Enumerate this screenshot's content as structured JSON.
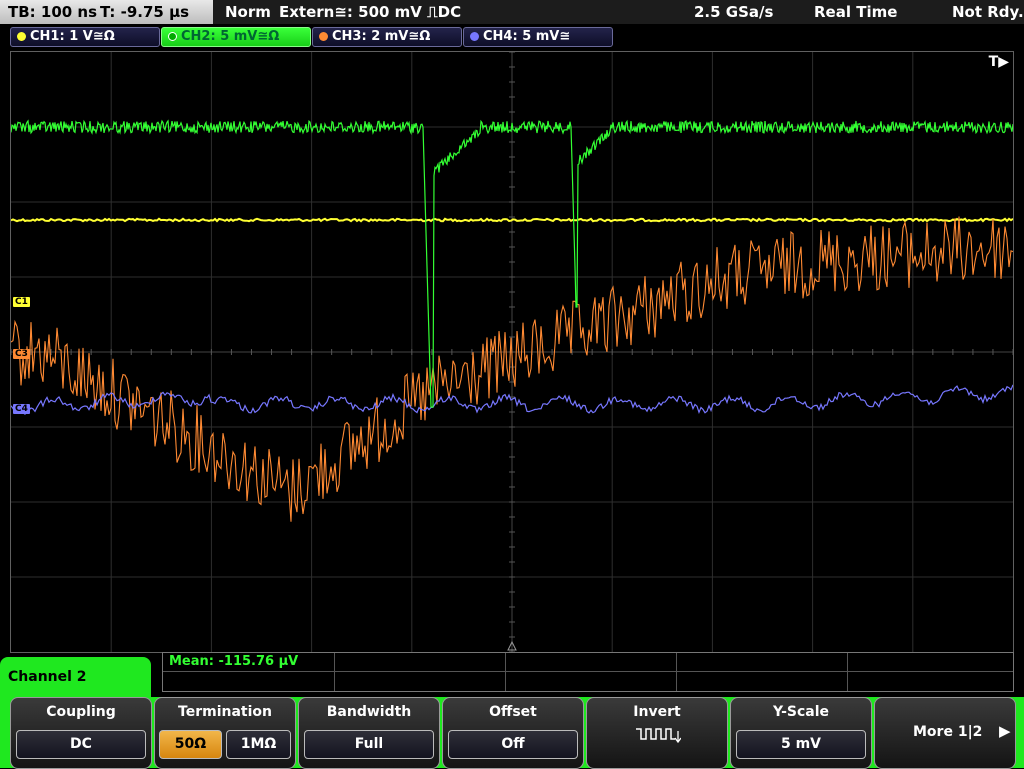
{
  "topbar": {
    "timebase": "TB: 100 ns",
    "trigger_time": "T: -9.75 µs",
    "mode": "Norm",
    "trigger_source": "Extern≅: 500 mV ⎍DC",
    "sample_rate": "2.5 GSa/s",
    "acq_mode": "Real Time",
    "status": "Not Rdy."
  },
  "channels": [
    {
      "label": "CH1: 1 V≅Ω",
      "color": "#ffff33",
      "active": false
    },
    {
      "label": "CH2: 5 mV≅Ω",
      "color": "#33ff33",
      "active": true
    },
    {
      "label": "CH3: 2 mV≅Ω",
      "color": "#ff8a33",
      "active": false
    },
    {
      "label": "CH4: 5 mV≅",
      "color": "#7777ff",
      "active": false
    }
  ],
  "graph": {
    "trigger_marker": "T▶",
    "markers": [
      "C1",
      "C3",
      "C4"
    ]
  },
  "measurement": {
    "text": "Mean: -115.76 µV"
  },
  "channel_panel": {
    "title": "Channel 2"
  },
  "softkeys": {
    "coupling": {
      "title": "Coupling",
      "value": "DC"
    },
    "termination": {
      "title": "Termination",
      "opt1": "50Ω",
      "opt2": "1MΩ"
    },
    "bandwidth": {
      "title": "Bandwidth",
      "value": "Full"
    },
    "offset": {
      "title": "Offset",
      "value": "Off"
    },
    "invert": {
      "title": "Invert"
    },
    "yscale": {
      "title": "Y-Scale",
      "value": "5 mV"
    },
    "more": {
      "label": "More 1|2"
    }
  }
}
